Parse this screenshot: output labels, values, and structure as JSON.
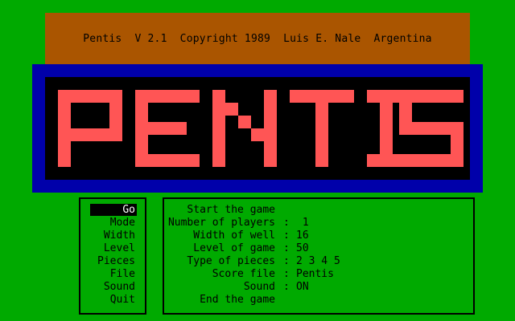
{
  "title_bar": {
    "text": "Pentis  V 2.1  Copyright 1989  Luis E. Nale  Argentina"
  },
  "logo": {
    "text": "PENTIS",
    "letter_color": "#ff5555",
    "background": "#000000",
    "frame_color": "#0000aa"
  },
  "colors": {
    "screen": "#00aa00",
    "title_bar": "#aa5500",
    "text": "#000000",
    "highlight_bg": "#000000",
    "highlight_fg": "#ffffff"
  },
  "menu": {
    "selected_index": 0,
    "items": [
      {
        "label": "Go"
      },
      {
        "label": "Mode"
      },
      {
        "label": "Width"
      },
      {
        "label": "Level"
      },
      {
        "label": "Pieces"
      },
      {
        "label": "File"
      },
      {
        "label": "Sound"
      },
      {
        "label": "Quit"
      }
    ]
  },
  "info": {
    "rows": [
      {
        "label": "Start the game",
        "sep": "",
        "value": ""
      },
      {
        "label": "Number of players",
        "sep": ":",
        "value": " 1"
      },
      {
        "label": "Width of well",
        "sep": ":",
        "value": "16"
      },
      {
        "label": "Level of game",
        "sep": ":",
        "value": "50"
      },
      {
        "label": "Type of pieces",
        "sep": ":",
        "value": "2 3 4 5"
      },
      {
        "label": "Score file",
        "sep": ":",
        "value": "Pentis"
      },
      {
        "label": "Sound",
        "sep": ":",
        "value": "ON"
      },
      {
        "label": "End the game",
        "sep": "",
        "value": ""
      }
    ]
  }
}
